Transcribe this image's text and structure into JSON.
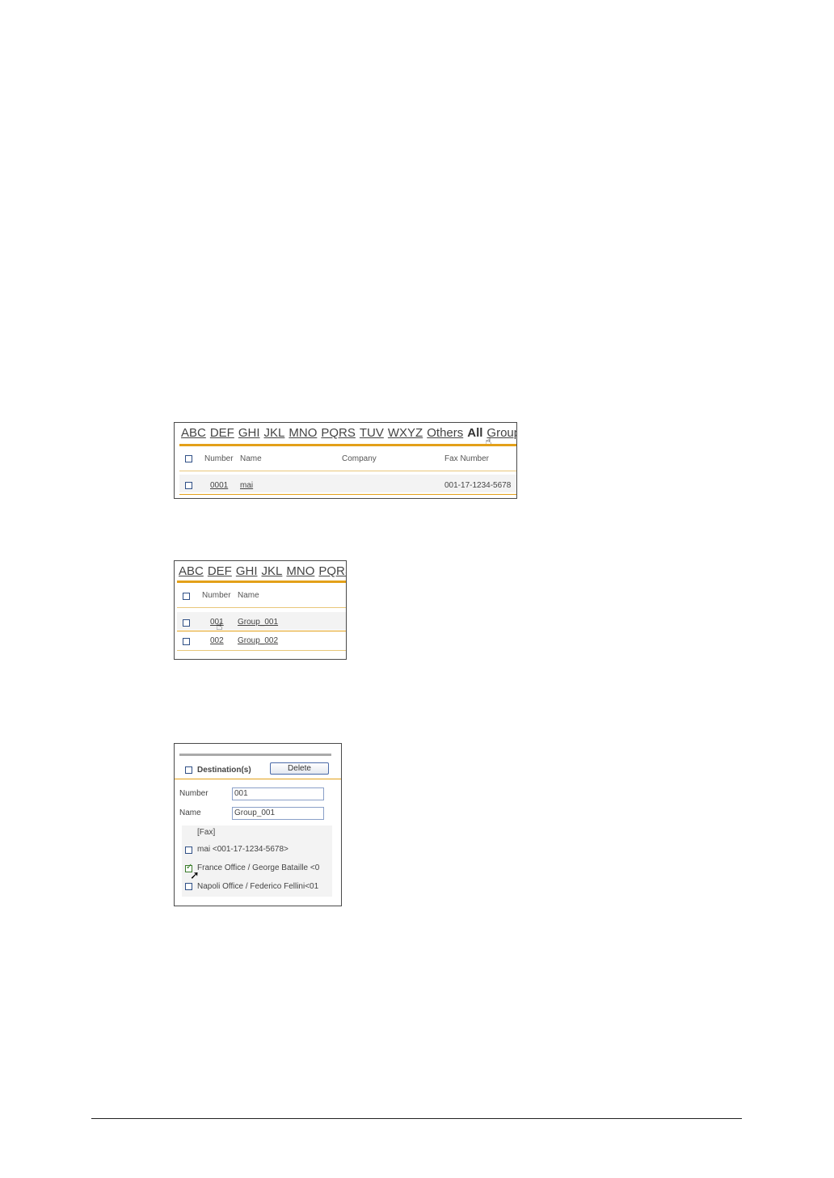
{
  "shot1": {
    "alpha_tabs": [
      "ABC",
      "DEF",
      "GHI",
      "JKL",
      "MNO",
      "PQRS",
      "TUV",
      "WXYZ",
      "Others"
    ],
    "current_tab": "All",
    "group_tab": "Group",
    "headers": {
      "number": "Number",
      "name": "Name",
      "company": "Company",
      "fax": "Fax Number"
    },
    "row": {
      "number": "0001",
      "name": "mai",
      "company": "",
      "fax": "001-17-1234-5678"
    }
  },
  "shot2": {
    "alpha_tabs": [
      "ABC",
      "DEF",
      "GHI",
      "JKL",
      "MNO",
      "PQRS"
    ],
    "headers": {
      "number": "Number",
      "name": "Name"
    },
    "rows": [
      {
        "number": "001",
        "name": "Group_001"
      },
      {
        "number": "002",
        "name": "Group_002"
      }
    ]
  },
  "shot3": {
    "destinations_label": "Destination(s)",
    "delete_label": "Delete",
    "number_label": "Number",
    "number_value": "001",
    "name_label": "Name",
    "name_value": "Group_001",
    "fax_heading": "[Fax]",
    "fax_entries": [
      {
        "label": "mai <001-17-1234-5678>",
        "checked": false
      },
      {
        "label": "France Office / George Bataille <0",
        "checked": true
      },
      {
        "label": "Napoli Office / Federico Fellini<01",
        "checked": false
      }
    ]
  },
  "colors": {
    "accent": "#e3a019",
    "checkbox": "#2f4f86"
  }
}
